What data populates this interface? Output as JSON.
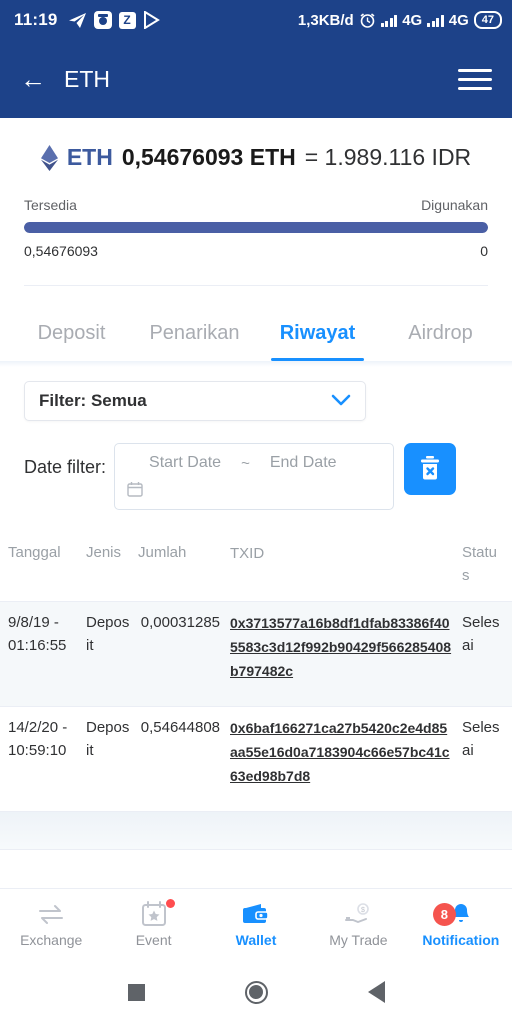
{
  "status_bar": {
    "time": "11:19",
    "network_speed": "1,3KB/d",
    "signal_1_label": "4G",
    "signal_2_label": "4G",
    "battery": "47",
    "left_icons": [
      "telegram-icon",
      "app-badge-icon",
      "app-z-icon",
      "play-store-icon"
    ],
    "right_icons": [
      "alarm-icon",
      "signal-bars-icon",
      "signal-bars-icon",
      "battery-icon"
    ]
  },
  "app_bar": {
    "back_icon": "back-arrow-icon",
    "title": "ETH",
    "menu_icon": "hamburger-menu-icon"
  },
  "balance": {
    "coin_icon": "ethereum-diamond-icon",
    "symbol": "ETH",
    "amount": "0,54676093 ETH",
    "equals": "= 1.989.116 IDR",
    "available_label": "Tersedia",
    "used_label": "Digunakan",
    "available_value": "0,54676093",
    "used_value": "0",
    "progress_percent": 100,
    "bar_color": "#4a5fa5",
    "symbol_color": "#3d5a9e"
  },
  "tabs": [
    {
      "label": "Deposit",
      "active": false
    },
    {
      "label": "Penarikan",
      "active": false
    },
    {
      "label": "Riwayat",
      "active": true
    },
    {
      "label": "Airdrop",
      "active": false
    }
  ],
  "filters": {
    "select_label": "Filter: Semua",
    "chevron_icon": "chevron-down-icon",
    "date_filter_label": "Date filter:",
    "start_date_placeholder": "Start Date",
    "range_separator": "~",
    "end_date_placeholder": "End Date",
    "calendar_icon": "calendar-icon",
    "clear_button_icon": "trash-delete-icon",
    "accent_color": "#1890ff"
  },
  "table": {
    "headers": {
      "date": "Tanggal",
      "type": "Jenis",
      "amount": "Jumlah",
      "txid": "TXID",
      "status": "Status"
    },
    "rows": [
      {
        "date": "9/8/19 - 01:16:55",
        "type": "Deposit",
        "amount": "0,00031285",
        "txid": "0x3713577a16b8df1dfab83386f405583c3d12f992b90429f566285408b797482c",
        "status": "Selesai"
      },
      {
        "date": "14/2/20 - 10:59:10",
        "type": "Deposit",
        "amount": "0,54644808",
        "txid": "0x6baf166271ca27b5420c2e4d85aa55e16d0a7183904c66e57bc41c63ed98b7d8",
        "status": "Selesai"
      }
    ]
  },
  "bottom_nav": [
    {
      "label": "Exchange",
      "icon": "exchange-arrows-icon",
      "active": false,
      "badge": null,
      "dot": false
    },
    {
      "label": "Event",
      "icon": "calendar-star-icon",
      "active": false,
      "badge": null,
      "dot": true
    },
    {
      "label": "Wallet",
      "icon": "wallet-icon",
      "active": true,
      "badge": null,
      "dot": false
    },
    {
      "label": "My Trade",
      "icon": "hand-coin-icon",
      "active": false,
      "badge": null,
      "dot": false
    },
    {
      "label": "Notification",
      "icon": "bell-icon",
      "active": true,
      "badge": "8",
      "dot": false
    }
  ],
  "android_nav": {
    "recents_icon": "square-recents-icon",
    "home_icon": "circle-home-icon",
    "back_icon": "triangle-back-icon"
  }
}
